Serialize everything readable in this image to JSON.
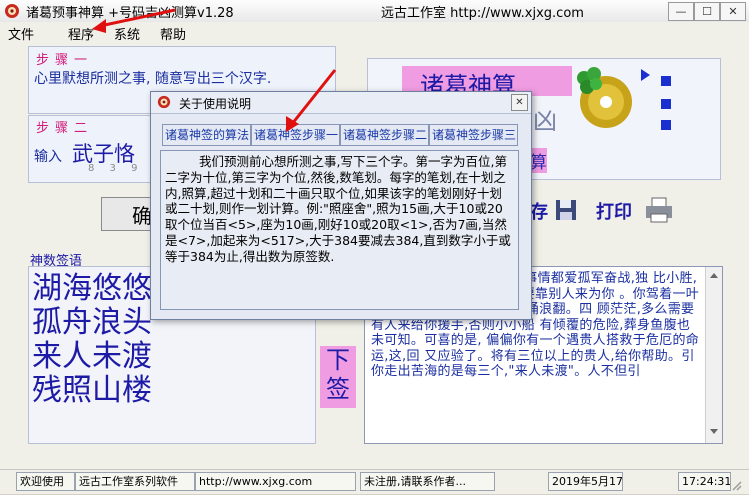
{
  "window": {
    "title": "诸葛预事神算 +号码吉凶测算v1.28",
    "center_title": "远古工作室 http://www.xjxg.com",
    "min_label": "—",
    "max_label": "☐",
    "close_label": "✕"
  },
  "menu": [
    "文件",
    "程序",
    "系统",
    "帮助"
  ],
  "step1": {
    "label": "步骤一",
    "text": "心里默想所测之事, 随意写出三个汉字."
  },
  "step2": {
    "label": "步骤二",
    "input_label": "输入",
    "chars": "武子恪",
    "stroke_counts": "8 3 9"
  },
  "confirm_button_char": "确",
  "logo": {
    "line1": "诸葛神算",
    "line2": "签",
    "line3": "凶",
    "line4": "算"
  },
  "save_button": "存",
  "print_button": "打印",
  "poem_section": {
    "label": "神数签语",
    "lines": [
      "湖海悠悠",
      "孤舟浪头",
      "来人未渡,",
      "残照山楼."
    ]
  },
  "sign_rank": [
    "下",
    "签"
  ],
  "interpretation": "么事情都爱孤军奋战,独 比小胜,却要比别人花费 也找局还要靠别人来为你 。你驾着一叶扁3航天茫 ,四处汹涌起,波涌浪翻。四 顾茫茫,多么需要有人来给你援手,否则小小船 有倾覆的危险,葬身鱼腹也未可知。可喜的是, 偏偏你有一个遇贵人搭救于危厄的命运,这,回 又应验了。将有三位以上的贵人,给你帮助。引 你走出苦海的是每三个,\"来人未渡\"。人不但引",
  "dialog": {
    "title": "关于使用说明",
    "close_label": "✕",
    "tabs": [
      "诸葛神签的算法",
      "诸葛神签步骤一",
      "诸葛神签步骤二",
      "诸葛神签步骤三"
    ],
    "content": "我们预测前心想所测之事,写下三个字。第一字为百位,第二字为十位,第三字为个位,然後,数笔划。每字的笔划,在十划之内,照算,超过十划和二十画只取个位,如果该字的笔划刚好十划或二十划,则作一划计算。例:\"照座舍\",照为15画,大于10或20取个位当百<5>,座为10画,刚好10或20取<1>,否为7画,当然是<7>,加起来为<517>,大于384要减去384,直到数字小于或等于384为止,得出数为原签数."
  },
  "status": {
    "welcome": "欢迎使用",
    "software": "远古工作室系列软件",
    "url": "http://www.xjxg.com",
    "register": "未注册,请联系作者...",
    "date": "2019年5月17日",
    "time": "17:24:31"
  },
  "colors": {
    "accent": "#1d1aa6",
    "step_label": "#d21d7a",
    "annotation_arrow": "#e01010"
  }
}
